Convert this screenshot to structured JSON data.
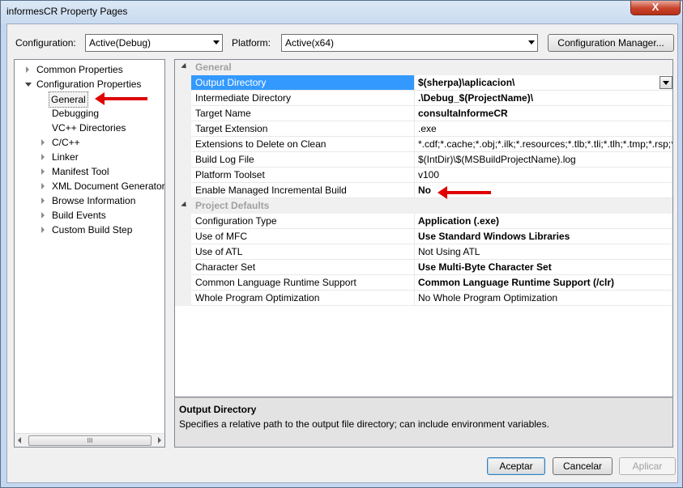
{
  "window": {
    "title": "informesCR Property Pages",
    "close_label": "X"
  },
  "config": {
    "label": "Configuration:",
    "value": "Active(Debug)"
  },
  "platform": {
    "label": "Platform:",
    "value": "Active(x64)"
  },
  "config_manager_label": "Configuration Manager...",
  "tree": {
    "items": [
      {
        "label": "Common Properties",
        "expand": "collapsed"
      },
      {
        "label": "Configuration Properties",
        "expand": "expanded"
      },
      {
        "label": "General",
        "expand": "none",
        "selected": true
      },
      {
        "label": "Debugging",
        "expand": "none"
      },
      {
        "label": "VC++ Directories",
        "expand": "none"
      },
      {
        "label": "C/C++",
        "expand": "collapsed"
      },
      {
        "label": "Linker",
        "expand": "collapsed"
      },
      {
        "label": "Manifest Tool",
        "expand": "collapsed"
      },
      {
        "label": "XML Document Generator",
        "expand": "collapsed"
      },
      {
        "label": "Browse Information",
        "expand": "collapsed"
      },
      {
        "label": "Build Events",
        "expand": "collapsed"
      },
      {
        "label": "Custom Build Step",
        "expand": "collapsed"
      }
    ],
    "scroll_thumb": "III"
  },
  "grid": {
    "cat_general": "General",
    "cat_defaults": "Project Defaults",
    "general_rows": [
      {
        "name": "Output Directory",
        "value": "$(sherpa)\\aplicacion\\",
        "bold": true
      },
      {
        "name": "Intermediate Directory",
        "value": ".\\Debug_$(ProjectName)\\",
        "bold": true
      },
      {
        "name": "Target Name",
        "value": "consultaInformeCR",
        "bold": true
      },
      {
        "name": "Target Extension",
        "value": ".exe",
        "bold": false
      },
      {
        "name": "Extensions to Delete on Clean",
        "value": "*.cdf;*.cache;*.obj;*.ilk;*.resources;*.tlb;*.tli;*.tlh;*.tmp;*.rsp;*",
        "bold": false
      },
      {
        "name": "Build Log File",
        "value": "$(IntDir)\\$(MSBuildProjectName).log",
        "bold": false
      },
      {
        "name": "Platform Toolset",
        "value": "v100",
        "bold": false
      },
      {
        "name": "Enable Managed Incremental Build",
        "value": "No",
        "bold": true
      }
    ],
    "defaults_rows": [
      {
        "name": "Configuration Type",
        "value": "Application (.exe)",
        "bold": true
      },
      {
        "name": "Use of MFC",
        "value": "Use Standard Windows Libraries",
        "bold": true
      },
      {
        "name": "Use of ATL",
        "value": "Not Using ATL",
        "bold": false
      },
      {
        "name": "Character Set",
        "value": "Use Multi-Byte Character Set",
        "bold": true
      },
      {
        "name": "Common Language Runtime Support",
        "value": "Common Language Runtime Support (/clr)",
        "bold": true
      },
      {
        "name": "Whole Program Optimization",
        "value": "No Whole Program Optimization",
        "bold": false
      }
    ]
  },
  "description": {
    "title": "Output Directory",
    "text": "Specifies a relative path to the output file directory; can include environment variables."
  },
  "buttons": {
    "ok": "Aceptar",
    "cancel": "Cancelar",
    "apply": "Aplicar"
  },
  "colors": {
    "selection": "#3399ff",
    "annotation_arrow": "#e00000"
  }
}
